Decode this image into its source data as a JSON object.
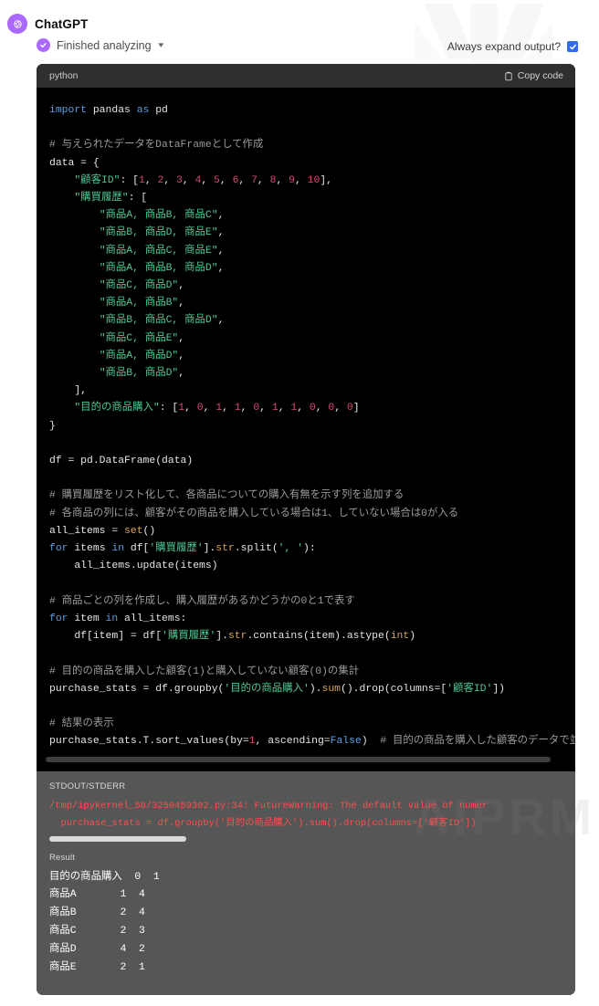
{
  "header": {
    "assistant_name": "ChatGPT",
    "avatar_icon": "openai-logo-icon",
    "status_text": "Finished analyzing",
    "status_icon": "check-circle-icon",
    "chevron_icon": "chevron-down-icon",
    "expand_label": "Always expand output?",
    "expand_checked": true,
    "checkbox_color": "#2f6fe0",
    "accent_color": "#ab68ff"
  },
  "code_block": {
    "language": "python",
    "copy_label": "Copy code",
    "copy_icon": "clipboard-icon",
    "lines": [
      {
        "t": "import",
        "c": "kw"
      },
      {
        "t": " pandas ",
        "c": "plain"
      },
      {
        "t": "as",
        "c": "kw"
      },
      {
        "t": " pd",
        "c": "plain"
      }
    ]
  },
  "code_text": "import pandas as pd\n\n# 与えられたデータをDataFrameとして作成\ndata = {\n    \"顧客ID\": [1, 2, 3, 4, 5, 6, 7, 8, 9, 10],\n    \"購買履歴\": [\n        \"商品A, 商品B, 商品C\",\n        \"商品B, 商品D, 商品E\",\n        \"商品A, 商品C, 商品E\",\n        \"商品A, 商品B, 商品D\",\n        \"商品C, 商品D\",\n        \"商品A, 商品B\",\n        \"商品B, 商品C, 商品D\",\n        \"商品C, 商品E\",\n        \"商品A, 商品D\",\n        \"商品B, 商品D\",\n    ],\n    \"目的の商品購入\": [1, 0, 1, 1, 0, 1, 1, 0, 0, 0]\n}\n\ndf = pd.DataFrame(data)\n\n# 購買履歴をリスト化して、各商品についての購入有無を示す列を追加する\n# 各商品の列には、顧客がその商品を購入している場合は1、していない場合は0が入る\nall_items = set()\nfor items in df['購買履歴'].str.split(', '):\n    all_items.update(items)\n\n# 商品ごとの列を作成し、購入履歴があるかどうかの0と1で表す\nfor item in all_items:\n    df[item] = df['購買履歴'].str.contains(item).astype(int)\n\n# 目的の商品を購入した顧客(1)と購入していない顧客(0)の集計\npurchase_stats = df.groupby('目的の商品購入').sum().drop(columns=['顧客ID'])\n\n# 結果の表示\npurchase_stats.T.sort_values(by=1, ascending=False)  # 目的の商品を購入した顧客のデータで並び",
  "stdout_section": {
    "label": "STDOUT/STDERR",
    "warning_line_1": "/tmp/ipykernel_58/3250459302.py:34: FutureWarning: The default value of numer",
    "warning_line_2": "  purchase_stats = df.groupby('目的の商品購入').sum().drop(columns=['顧客ID'])",
    "warning_color": "#ff4d4d"
  },
  "result_section": {
    "label": "Result",
    "header_row": [
      "目的の商品購入",
      "0",
      "1"
    ],
    "rows": [
      {
        "label": "商品A",
        "col0": "1",
        "col1": "4"
      },
      {
        "label": "商品B",
        "col0": "2",
        "col1": "4"
      },
      {
        "label": "商品C",
        "col0": "2",
        "col1": "3"
      },
      {
        "label": "商品D",
        "col0": "4",
        "col1": "2"
      },
      {
        "label": "商品E",
        "col0": "2",
        "col1": "1"
      }
    ],
    "table_text": "目的の商品購入  0  1\n商品A       1  4\n商品B       2  4\n商品C       2  3\n商品D       4  2\n商品E       2  1"
  },
  "chart_data": {
    "type": "table",
    "title": "目的の商品購入",
    "categories": [
      "商品A",
      "商品B",
      "商品C",
      "商品D",
      "商品E"
    ],
    "series": [
      {
        "name": "0",
        "values": [
          1,
          2,
          2,
          4,
          2
        ]
      },
      {
        "name": "1",
        "values": [
          4,
          4,
          3,
          2,
          1
        ]
      }
    ]
  }
}
